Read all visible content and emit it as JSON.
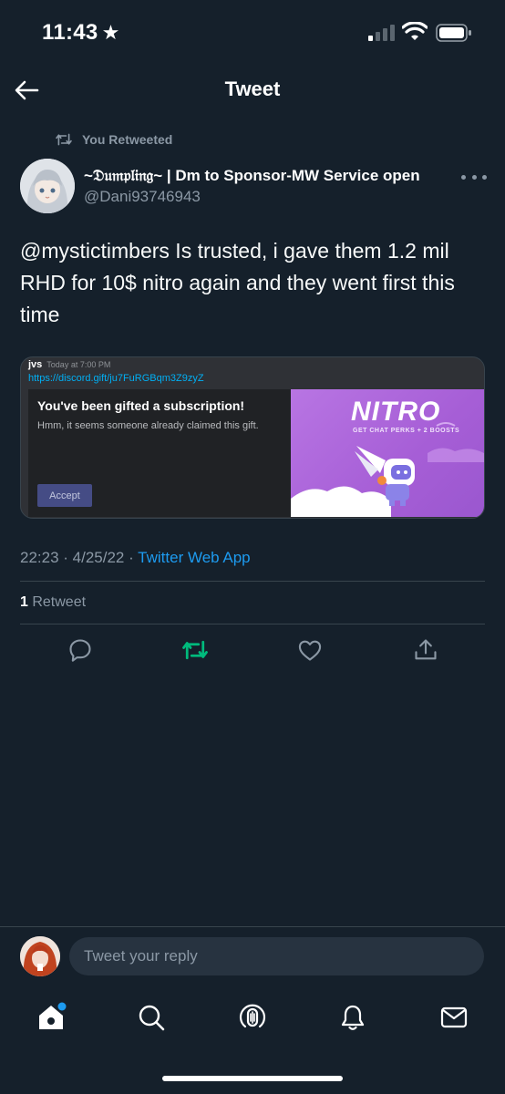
{
  "status_bar": {
    "time": "11:43",
    "star": "★"
  },
  "header": {
    "title": "Tweet",
    "back_icon": "arrow-left-icon"
  },
  "retweet_banner": {
    "text": "You Retweeted",
    "icon": "retweet-icon"
  },
  "tweet": {
    "author_name": "~𝔇𝔲𝔪𝔭𝔩𝔦𝔫𝔤~ | Dm to Sponsor-MW Service open",
    "author_handle": "@Dani93746943",
    "text": "@mystictimbers Is trusted, i gave them 1.2 mil RHD for 10$ nitro again and they went first this time",
    "media": {
      "username": "jvs",
      "time": "Today at 7:00 PM",
      "link": "https://discord.gift/ju7FuRGBqm3Z9zyZ",
      "gift_title": "You've been gifted a subscription!",
      "gift_message": "Hmm, it seems someone already claimed this gift.",
      "accept_label": "Accept",
      "nitro_logo": "NITRO",
      "nitro_tagline": "GET CHAT PERKS + 2 BOOSTS"
    },
    "timestamp": "22:23 · 4/25/22 · ",
    "source": "Twitter Web App",
    "retweet_count": "1",
    "retweet_label": " Retweet"
  },
  "actions": [
    "reply-icon",
    "retweet-icon",
    "like-icon",
    "share-icon"
  ],
  "reply": {
    "placeholder": "Tweet your reply"
  },
  "tab_bar": [
    "home-icon",
    "search-icon",
    "spaces-icon",
    "notifications-icon",
    "messages-icon"
  ],
  "colors": {
    "background": "#15202b",
    "accent": "#1d9bf0",
    "retweet_green": "#00ba7c",
    "secondary_text": "#8b98a5",
    "divider": "#38444d"
  }
}
